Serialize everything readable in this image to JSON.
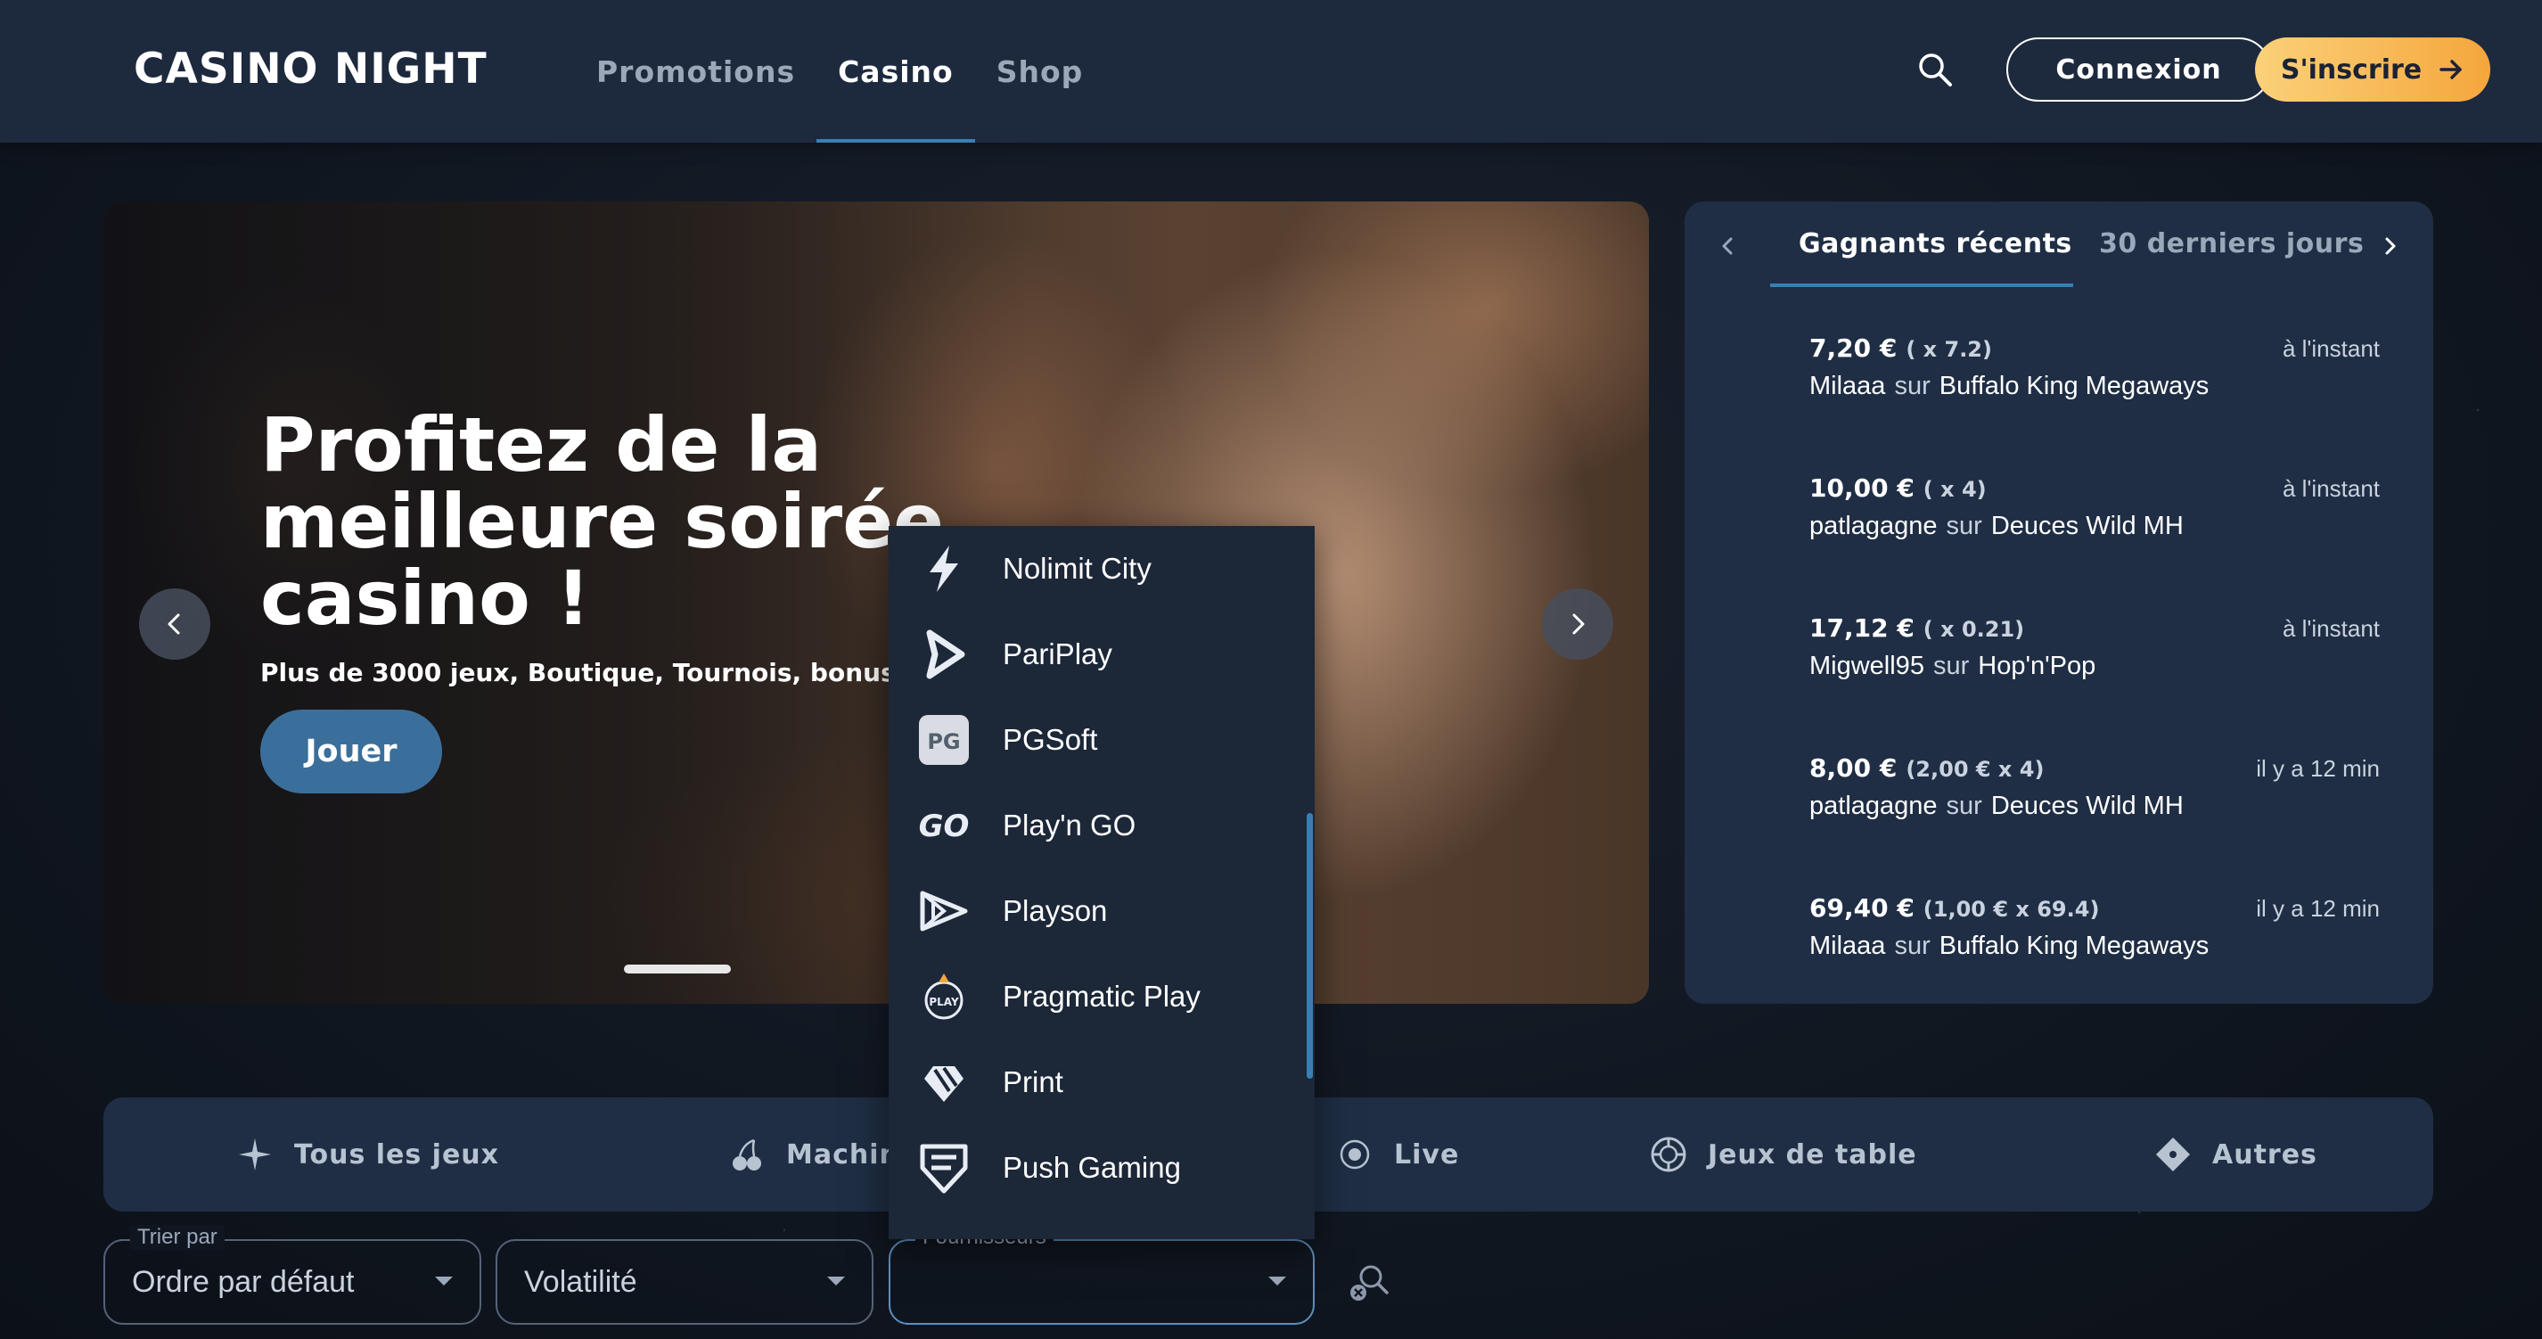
{
  "header": {
    "logo": "CASINO NIGHT",
    "nav": [
      {
        "label": "Promotions",
        "active": false
      },
      {
        "label": "Casino",
        "active": true
      },
      {
        "label": "Shop",
        "active": false
      }
    ],
    "search_icon": "search-icon",
    "login_label": "Connexion",
    "signup_label": "S'inscrire"
  },
  "hero": {
    "title": "Profitez de la meilleure soirée casino !",
    "subtitle": "Plus de 3000 jeux, Boutique, Tournois, bonus..",
    "cta_label": "Jouer"
  },
  "winners": {
    "tabs": [
      {
        "label": "Gagnants récents",
        "active": true
      },
      {
        "label": "30 derniers jours",
        "active": false
      }
    ],
    "sur_label": "sur",
    "rows": [
      {
        "amount": "7,20 €",
        "multiplier": "( x 7.2)",
        "time": "à l'instant",
        "player": "Milaaa",
        "game": "Buffalo King Megaways"
      },
      {
        "amount": "10,00 €",
        "multiplier": "( x 4)",
        "time": "à l'instant",
        "player": "patlagagne",
        "game": "Deuces Wild MH"
      },
      {
        "amount": "17,12 €",
        "multiplier": "( x 0.21)",
        "time": "à l'instant",
        "player": "Migwell95",
        "game": "Hop'n'Pop"
      },
      {
        "amount": "8,00 €",
        "multiplier": "(2,00 € x 4)",
        "time": "il y a 12 min",
        "player": "patlagagne",
        "game": "Deuces Wild MH"
      },
      {
        "amount": "69,40 €",
        "multiplier": "(1,00 € x 69.4)",
        "time": "il y a 12 min",
        "player": "Milaaa",
        "game": "Buffalo King Megaways"
      }
    ]
  },
  "categories": [
    {
      "label": "Tous les jeux",
      "icon": "sparkle-icon"
    },
    {
      "label": "Machines à sous",
      "icon": "cherry-icon"
    },
    {
      "label": "Live",
      "icon": "live-icon"
    },
    {
      "label": "Jeux de table",
      "icon": "chip-icon"
    },
    {
      "label": "Autres",
      "icon": "diamond-icon"
    }
  ],
  "filters": {
    "sort_legend": "Trier par",
    "sort_value": "Ordre par défaut",
    "volatility_placeholder": "Volatilité",
    "providers_legend": "Fournisseurs",
    "providers_value": ""
  },
  "providers_dropdown": [
    {
      "label": "Nolimit City",
      "icon": "lightning-icon"
    },
    {
      "label": "PariPlay",
      "icon": "pariplay-icon"
    },
    {
      "label": "PGSoft",
      "icon": "pg-icon"
    },
    {
      "label": "Play'n GO",
      "icon": "go-icon"
    },
    {
      "label": "Playson",
      "icon": "playson-icon"
    },
    {
      "label": "Pragmatic Play",
      "icon": "pragmatic-icon"
    },
    {
      "label": "Print",
      "icon": "print-icon"
    },
    {
      "label": "Push Gaming",
      "icon": "push-gaming-icon"
    }
  ],
  "colors": {
    "header_bg": "#1d2a3e",
    "panel_bg": "#1f2e44",
    "accent_blue": "#3a7fb4",
    "signup_gradient_start": "#fbd17a",
    "signup_gradient_end": "#f5a63c"
  }
}
